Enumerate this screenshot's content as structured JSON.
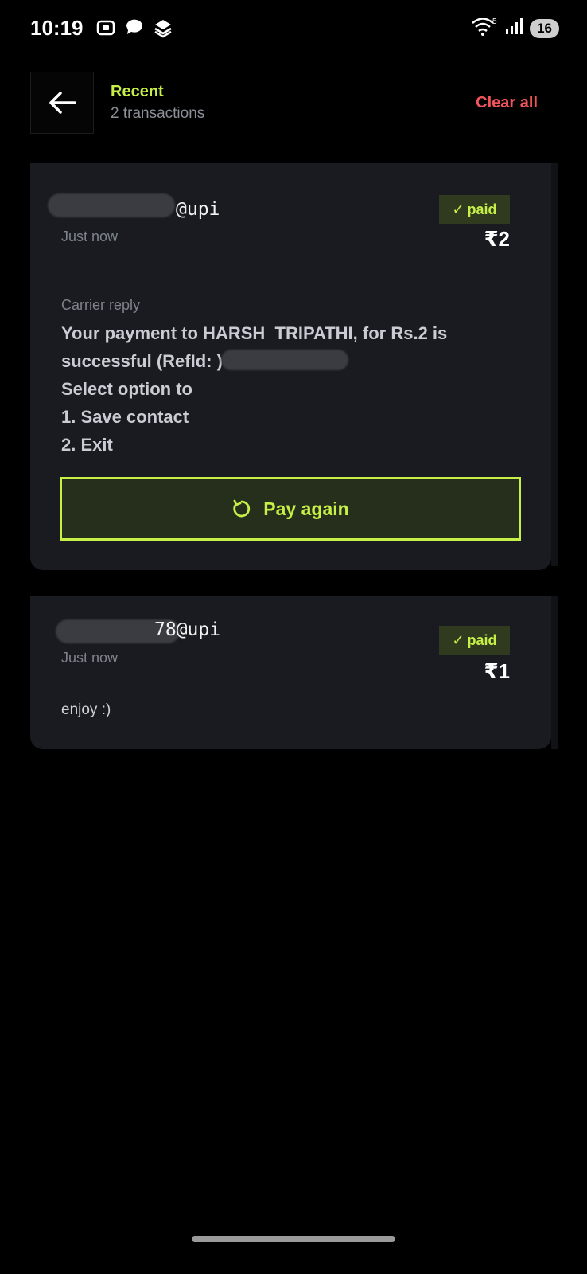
{
  "status_bar": {
    "time": "10:19",
    "wifi_label": "5",
    "battery": "16",
    "icons": [
      "screen-record-icon",
      "chat-bubble-icon",
      "stack-app-icon",
      "wifi-icon",
      "signal-icon",
      "battery-icon"
    ]
  },
  "header": {
    "title": "Recent",
    "subtitle": "2 transactions",
    "clear_label": "Clear all"
  },
  "transactions": [
    {
      "upi_id_visible": "@upi",
      "time": "Just now",
      "status": "paid",
      "status_check": "✓",
      "amount": "₹2",
      "carrier_label": "Carrier reply",
      "carrier_lines": [
        "Your payment to HARSH  TRIPATHI, for Rs.2 is",
        "successful (RefId: ) .",
        "Select option to",
        "1. Save contact",
        "2. Exit"
      ],
      "action_label": "Pay again"
    },
    {
      "upi_id_visible": "78@upi",
      "time": "Just now",
      "status": "paid",
      "status_check": "✓",
      "amount": "₹1",
      "note": "enjoy :)"
    }
  ],
  "colors": {
    "accent": "#c6f047",
    "danger": "#f0545a",
    "card": "#191b20",
    "background": "#000000"
  }
}
